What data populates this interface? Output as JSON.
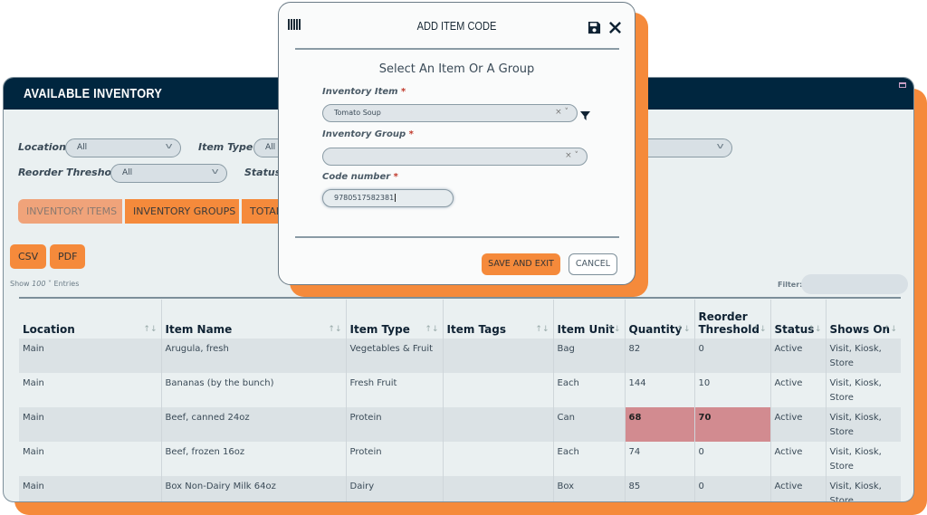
{
  "page": {
    "title": "AVAILABLE INVENTORY",
    "colors": {
      "accent": "#f58a3b",
      "header": "#00263f",
      "highlight": "#d28b90"
    }
  },
  "filters": {
    "location": {
      "label": "Location",
      "value": "All"
    },
    "item_type": {
      "label": "Item Type",
      "value": "All"
    },
    "reorder_threshold": {
      "label": "Reorder Threshold",
      "value": "All"
    },
    "status": {
      "label": "Status"
    }
  },
  "tabs": [
    {
      "label": "INVENTORY ITEMS",
      "active": true
    },
    {
      "label": "INVENTORY GROUPS"
    },
    {
      "label": "TOTAL"
    }
  ],
  "export": {
    "csv": "CSV",
    "pdf": "PDF"
  },
  "entries": {
    "show": "Show",
    "value": "100",
    "suffix": "Entries"
  },
  "filter": {
    "label": "Filter:",
    "value": ""
  },
  "table": {
    "columns": [
      "Location",
      "Item Name",
      "Item Type",
      "Item Tags",
      "Item Unit",
      "Quantity",
      "Reorder Threshold",
      "Status",
      "Shows On"
    ],
    "rows": [
      [
        "Main",
        "Arugula, fresh",
        "Vegetables & Fruit",
        "",
        "Bag",
        "82",
        "0",
        "Active",
        "Visit, Kiosk, Store"
      ],
      [
        "Main",
        "Bananas (by the bunch)",
        "Fresh Fruit",
        "",
        "Each",
        "144",
        "10",
        "Active",
        "Visit, Kiosk, Store"
      ],
      [
        "Main",
        "Beef, canned 24oz",
        "Protein",
        "",
        "Can",
        "68",
        "70",
        "Active",
        "Visit, Kiosk, Store"
      ],
      [
        "Main",
        "Beef, frozen 16oz",
        "Protein",
        "",
        "Each",
        "74",
        "0",
        "Active",
        "Visit, Kiosk, Store"
      ],
      [
        "Main",
        "Box Non-Dairy Milk 64oz",
        "Dairy",
        "",
        "Box",
        "85",
        "0",
        "Active",
        "Visit, Kiosk, Store"
      ]
    ],
    "highlighted_rows": [
      2
    ]
  },
  "modal": {
    "title": "ADD ITEM CODE",
    "icons": {
      "left": "barcode-icon",
      "save": "save-icon",
      "close": "close-icon",
      "filter": "filter-icon"
    },
    "subtitle": "Select An Item Or A Group",
    "item_label": "Inventory Item",
    "item_value": "Tomato Soup",
    "group_label": "Inventory Group",
    "group_value": "",
    "code_label": "Code number",
    "code_value": "9780517582381",
    "required": "*",
    "save_exit": "SAVE AND EXIT",
    "cancel": "CANCEL"
  }
}
